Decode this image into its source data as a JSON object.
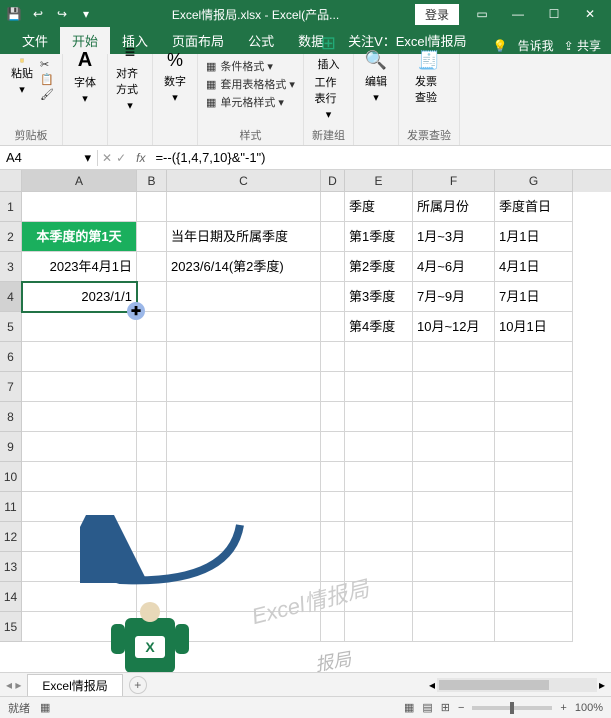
{
  "titlebar": {
    "doc_name": "Excel情报局.xlsx - Excel(产品...",
    "login": "登录"
  },
  "tabs": {
    "file": "文件",
    "home": "开始",
    "insert": "插入",
    "layout": "页面布局",
    "formula": "公式",
    "data": "数据",
    "follow": "关注V：Excel情报局",
    "tellme": "告诉我",
    "share": "共享"
  },
  "ribbon": {
    "paste": "粘贴",
    "clipboard": "剪贴板",
    "font": "字体",
    "align": "对齐方式",
    "number": "数字",
    "cond_fmt": "条件格式 ▾",
    "table_fmt": "套用表格格式 ▾",
    "cell_fmt": "单元格样式 ▾",
    "styles": "样式",
    "insert_btn": "插入",
    "worksheet": "工作表行",
    "newgroup": "新建组",
    "edit": "编辑",
    "invoice": "发票查验",
    "invoice_group": "发票查验"
  },
  "fbar": {
    "namebox": "A4",
    "formula": "=--({1,4,7,10}&\"-1\")"
  },
  "cols": [
    "A",
    "B",
    "C",
    "D",
    "E",
    "F",
    "G"
  ],
  "sheet": {
    "r1": {
      "E": "季度",
      "F": "所属月份",
      "G": "季度首日"
    },
    "r2": {
      "A": "本季度的第1天",
      "C": "当年日期及所属季度",
      "E": "第1季度",
      "F": "1月~3月",
      "G": "1月1日"
    },
    "r3": {
      "A": "2023年4月1日",
      "C": "2023/6/14(第2季度)",
      "E": "第2季度",
      "F": "4月~6月",
      "G": "4月1日"
    },
    "r4": {
      "A": "2023/1/1",
      "E": "第3季度",
      "F": "7月~9月",
      "G": "7月1日"
    },
    "r5": {
      "E": "第4季度",
      "F": "10月~12月",
      "G": "10月1日"
    }
  },
  "sheet_tab": "Excel情报局",
  "status": {
    "ready": "就绪",
    "zoom": "100%"
  },
  "watermark": "Excel情报局",
  "watermark2": "报局"
}
